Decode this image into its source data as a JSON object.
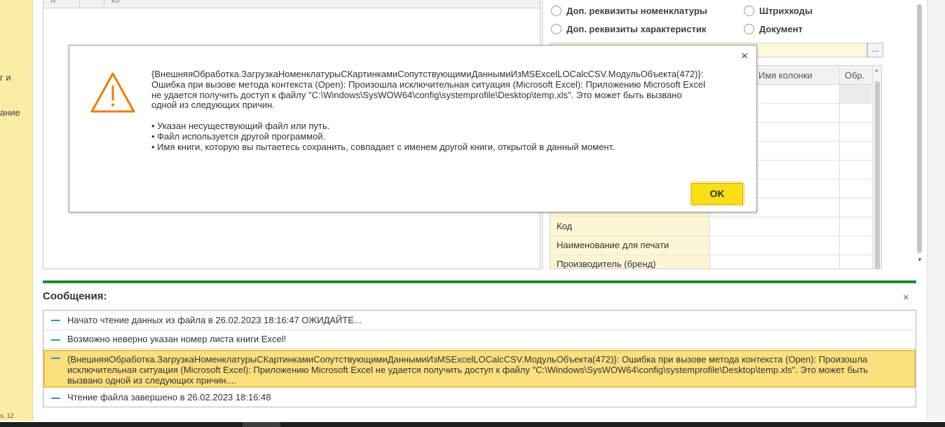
{
  "sidebar": {
    "fragment1": "и",
    "fragment1_prefix": "г",
    "fragment2": "ание",
    "bottom_text": "э, 12"
  },
  "left_table": {
    "col1": "N",
    "col2": "Ко"
  },
  "options": {
    "opt1": "Доп. реквизиты номенклатуры",
    "opt2": "Штрихкоды",
    "opt3": "Доп. реквизиты характеристик",
    "opt4": "Документ"
  },
  "file_button": "...",
  "columns_table": {
    "col_name_header": "Имя колонки",
    "col_proc_header": "Обр.",
    "rows": [
      "Код",
      "Наименование для печати",
      "Производитель (бренд)"
    ]
  },
  "messages": {
    "title": "Сообщения:",
    "close": "×",
    "items": [
      "Начато чтение данных из файла в 26.02.2023 18:16:47 ОЖИДАЙТЕ...",
      "Возможно неверно указан номер листа книги Excel!",
      "{ВнешняяОбработка.ЗагрузкаНоменклатурыСКартинкамиСопутствующимиДаннымиИзMSExcelLOCalcCSV.МодульОбъекта(472)}: Ошибка при вызове метода контекста (Open): Произошла исключительная ситуация (Microsoft Excel): Приложению Microsoft Excel не удается получить доступ к файлу \"C:\\Windows\\SysWOW64\\config\\systemprofile\\Desktop\\temp.xls\". Это может быть вызвано одной из следующих причин....",
      "Чтение файла завершено в 26.02.2023 18:16:48"
    ]
  },
  "dialog": {
    "close": "×",
    "text_main": "{ВнешняяОбработка.ЗагрузкаНоменклатурыСКартинкамиСопутствующимиДаннымиИзMSExcelLOCalcCSV.МодульОбъекта(472)}:\nОшибка при вызове метода контекста (Open): Произошла исключительная ситуация (Microsoft Excel): Приложению Microsoft Excel\nне удается получить доступ к файлу \"C:\\Windows\\SysWOW64\\config\\systemprofile\\Desktop\\temp.xls\". Это может быть вызвано\nодной из следующих причин.",
    "reason1": "• Указан несуществующий файл или путь.",
    "reason2": "• Файл используется другой программой.",
    "reason3": "• Имя книги, которую вы пытаетесь сохранить, совпадает с именем другой книги, открытой в данный момент.",
    "ok_label": "OK"
  },
  "colors": {
    "sidebar_bg": "#fbeda5",
    "accent_green": "#1b8b3f",
    "ok_button": "#fadf17",
    "selected_message": "#fcdf7e",
    "warning_icon": "#f07c00"
  },
  "icons": [
    "warning-icon",
    "close-icon",
    "radio-icon",
    "scroll-up-icon",
    "scroll-down-icon"
  ]
}
